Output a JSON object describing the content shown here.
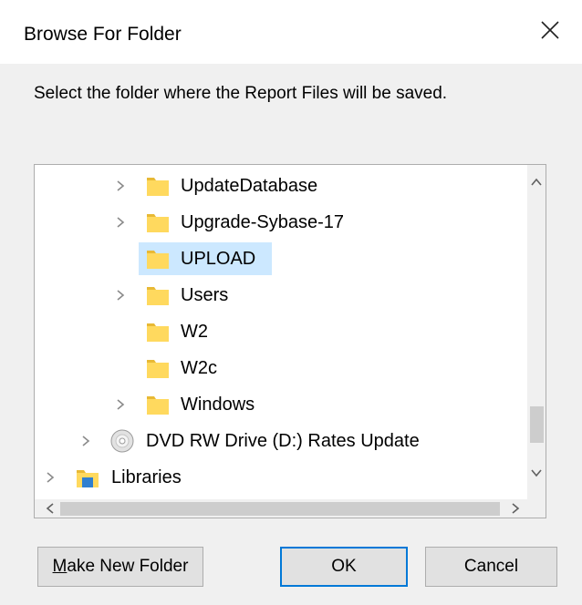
{
  "window": {
    "title": "Browse For Folder"
  },
  "instruction": "Select the folder where the Report Files will be saved.",
  "tree": {
    "items": [
      {
        "label": "UpdateDatabase",
        "expandable": true,
        "icon": "folder-icon",
        "selected": false
      },
      {
        "label": "Upgrade-Sybase-17",
        "expandable": true,
        "icon": "folder-icon",
        "selected": false
      },
      {
        "label": "UPLOAD",
        "expandable": false,
        "icon": "folder-icon",
        "selected": true
      },
      {
        "label": "Users",
        "expandable": true,
        "icon": "folder-icon",
        "selected": false
      },
      {
        "label": "W2",
        "expandable": false,
        "icon": "folder-icon",
        "selected": false
      },
      {
        "label": "W2c",
        "expandable": false,
        "icon": "folder-icon",
        "selected": false
      },
      {
        "label": "Windows",
        "expandable": true,
        "icon": "folder-icon",
        "selected": false
      },
      {
        "label": "DVD RW Drive (D:) Rates Update",
        "expandable": true,
        "icon": "dvd-drive-icon",
        "selected": false
      },
      {
        "label": "Libraries",
        "expandable": true,
        "icon": "libraries-icon",
        "selected": false
      }
    ]
  },
  "buttons": {
    "make_new_folder_mnemonic": "M",
    "make_new_folder_rest": "ake New Folder",
    "ok": "OK",
    "cancel": "Cancel"
  },
  "colors": {
    "selection": "#cce8ff",
    "default_button_border": "#0078d7",
    "folder": "#ffd95e",
    "dialog_bg": "#f0f0f0"
  }
}
